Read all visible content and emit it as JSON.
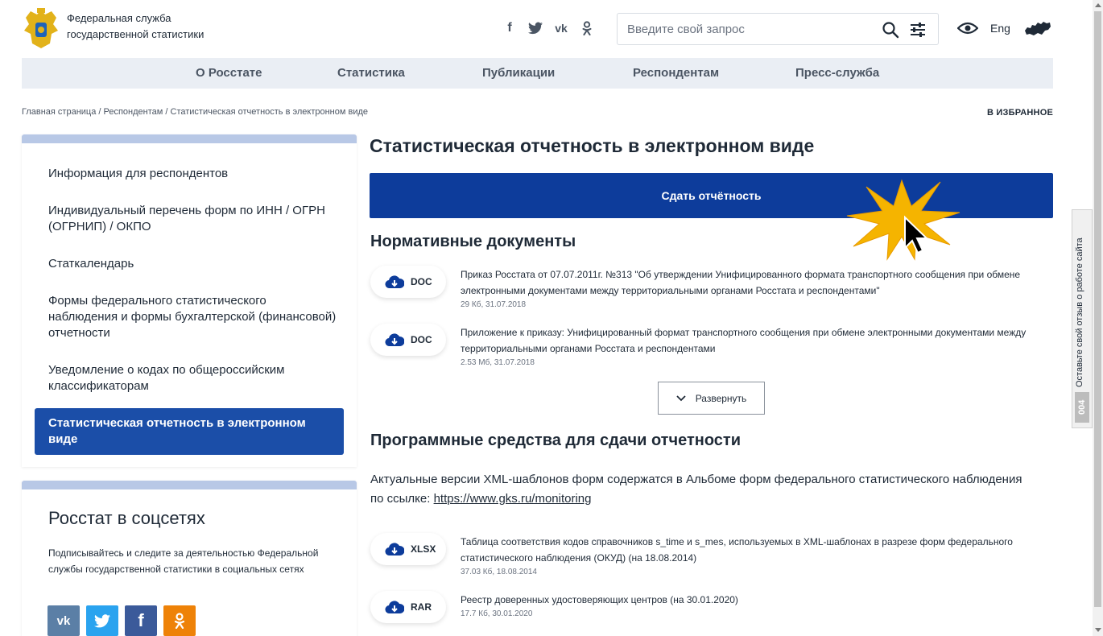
{
  "header": {
    "org_name_line1": "Федеральная служба",
    "org_name_line2": "государственной статистики",
    "search_placeholder": "Введите свой запрос",
    "lang": "Eng",
    "social_icons": [
      "facebook-icon",
      "twitter-icon",
      "vk-icon",
      "odnoklassniki-icon"
    ]
  },
  "nav": {
    "items": [
      "О Росстате",
      "Статистика",
      "Публикации",
      "Респондентам",
      "Пресс-служба"
    ]
  },
  "breadcrumb": {
    "text": "Главная страница / Респондентам / Статистическая отчетность в электронном виде"
  },
  "favorite_label": "В ИЗБРАННОЕ",
  "sidebar": {
    "items": [
      "Информация для респондентов",
      "Индивидуальный перечень форм по ИНН / ОГРН (ОГРНИП) / ОКПО",
      "Статкалендарь",
      "Формы федерального статистического наблюдения и формы бухгалтерской (финансовой) отчетности",
      "Уведомление о кодах по общероссийским классификаторам",
      "Статистическая отчетность в электронном виде"
    ],
    "active_index": 5
  },
  "social_box": {
    "title": "Росстат в соцсетях",
    "description": "Подписывайтесь и следите за деятельностью Федеральной службы государственной статистики в социальных сетях",
    "buttons": [
      {
        "icon": "vk-icon",
        "glyph": "vk",
        "color": "#5b7fa6"
      },
      {
        "icon": "twitter-icon",
        "glyph": "🐦",
        "color": "#2aa3ef"
      },
      {
        "icon": "facebook-icon",
        "glyph": "f",
        "color": "#3b5a9a"
      },
      {
        "icon": "odnoklassniki-icon",
        "glyph": "ok",
        "color": "#ee8208"
      }
    ]
  },
  "main": {
    "title": "Статистическая отчетность в электронном виде",
    "submit_button": "Сдать отчётность",
    "section1_title": "Нормативные документы",
    "documents": [
      {
        "ext": "DOC",
        "title": "Приказ Росстата от 07.07.2011г. №313 \"Об утверждении Унифицированного формата транспортного сообщения при обмене электронными документами между территориальными органами Росстата и респондентами\"",
        "meta": "29 Кб, 31.07.2018"
      },
      {
        "ext": "DOC",
        "title": "Приложение к приказу: Унифицированный формат транспортного сообщения при обмене электронными документами между территориальными органами Росстата и респондентами",
        "meta": "2.53 Мб, 31.07.2018"
      }
    ],
    "expand_button": "Развернуть",
    "section2_title": "Программные средства для сдачи отчетности",
    "paragraph_text": "Актуальные версии XML-шаблонов форм содержатся в Альбоме форм федерального статистического наблюдения по ссылке: ",
    "paragraph_link": "https://www.gks.ru/monitoring",
    "software_files": [
      {
        "ext": "XLSX",
        "title": "Таблица соответствия кодов справочников s_time и s_mes, используемых в XML-шаблонах в разрезе форм федерального статистического наблюдения (ОКУД) (на 18.08.2014)",
        "meta": "37.03 Кб, 18.08.2014"
      },
      {
        "ext": "RAR",
        "title": "Реестр доверенных удостоверяющих центров (на 30.01.2020)",
        "meta": "17.7 Кб, 30.01.2020"
      }
    ]
  },
  "feedback_tab": {
    "text": "Оставьте свой отзыв о работе сайта",
    "code": "004"
  },
  "colors": {
    "primary_blue": "#0d3c9b",
    "active_sidebar": "#1b4ea8",
    "nav_bg": "#eaeef4",
    "burst_yellow": "#f5b400"
  }
}
